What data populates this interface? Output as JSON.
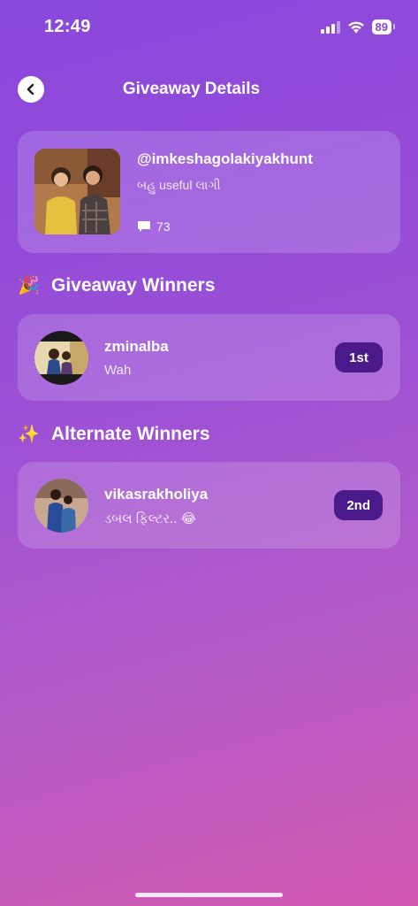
{
  "status": {
    "time": "12:49",
    "battery": "89"
  },
  "header": {
    "title": "Giveaway Details"
  },
  "post": {
    "username": "@imkeshagolakiyakhunt",
    "comment": "બહુ useful લાગી",
    "comment_count": "73"
  },
  "sections": {
    "winners": {
      "emoji": "🎉",
      "title": "Giveaway Winners"
    },
    "alternate": {
      "emoji": "✨",
      "title": "Alternate Winners"
    }
  },
  "winners": [
    {
      "username": "zminalba",
      "comment": "Wah",
      "rank": "1st"
    }
  ],
  "alternates": [
    {
      "username": "vikasrakholiya",
      "comment": "ડબલ ફિલ્ટર.. 😂",
      "rank": "2nd"
    }
  ]
}
